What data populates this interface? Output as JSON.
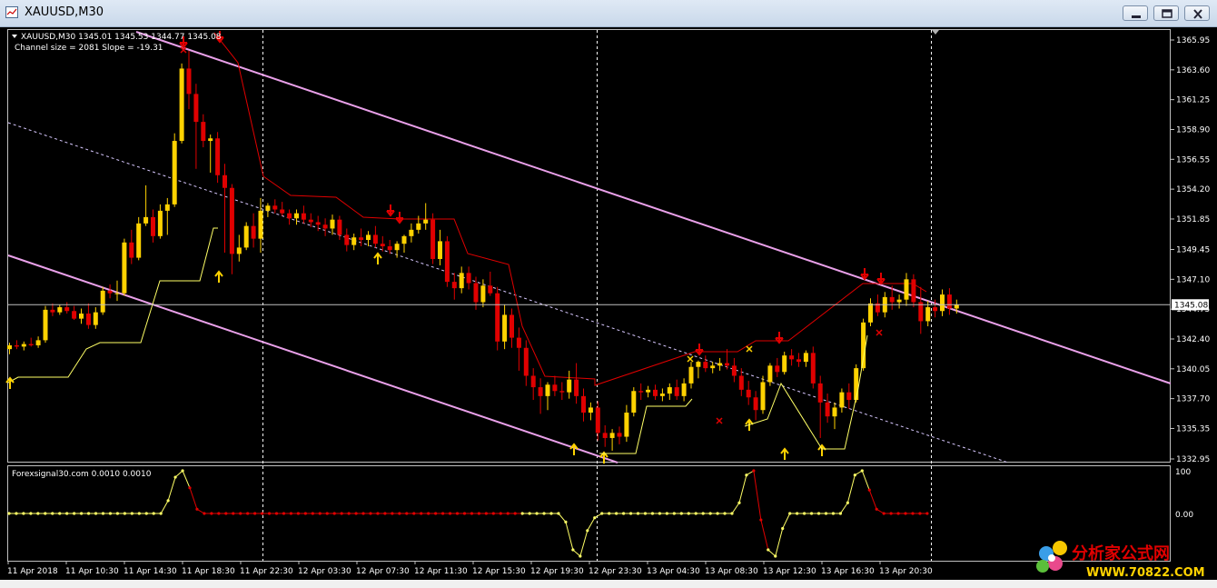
{
  "window": {
    "title": "XAUUSD,M30",
    "icon": "chart-window-icon",
    "buttons": [
      "minimize-icon",
      "restore-icon",
      "close-icon"
    ]
  },
  "chart": {
    "info_line": "XAUUSD,M30  1345.01 1345.53 1344.77 1345.08",
    "channel_line": "Channel size = 2081 Slope = -19.31",
    "current_price_label": "1345.08",
    "indicator_label": "Forexsignal30.com 0.0010 0.0010",
    "indicator_axis": [
      "100",
      "0.00"
    ],
    "watermark_top": "分析家公式网",
    "watermark_bottom": "WWW.70822.COM",
    "colors": {
      "bull": "#ffd200",
      "bear": "#e00000",
      "channel": "#e9a0e9",
      "stop_red": "#e00000",
      "stop_yellow": "#ffff66",
      "grid": "#ffffff"
    }
  },
  "chart_data": {
    "type": "candlestick",
    "symbol": "XAUUSD",
    "timeframe": "M30",
    "y_ticks": [
      1365.95,
      1363.6,
      1361.25,
      1358.9,
      1356.55,
      1354.2,
      1351.85,
      1349.45,
      1347.1,
      1344.75,
      1342.4,
      1340.05,
      1337.7,
      1335.35,
      1332.95
    ],
    "x_ticks": [
      "11 Apr 2018",
      "11 Apr 10:30",
      "11 Apr 14:30",
      "11 Apr 18:30",
      "11 Apr 22:30",
      "12 Apr 03:30",
      "12 Apr 07:30",
      "12 Apr 11:30",
      "12 Apr 15:30",
      "12 Apr 19:30",
      "12 Apr 23:30",
      "13 Apr 04:30",
      "13 Apr 08:30",
      "13 Apr 12:30",
      "13 Apr 16:30",
      "13 Apr 20:30"
    ],
    "ohlc": [
      [
        1341.6,
        1342.1,
        1341.2,
        1341.9
      ],
      [
        1341.9,
        1342.3,
        1341.6,
        1341.8
      ],
      [
        1341.8,
        1342.2,
        1341.5,
        1342.0
      ],
      [
        1342.0,
        1342.5,
        1341.8,
        1341.9
      ],
      [
        1341.9,
        1342.6,
        1341.7,
        1342.3
      ],
      [
        1342.3,
        1345.0,
        1342.1,
        1344.7
      ],
      [
        1344.7,
        1345.2,
        1344.2,
        1344.5
      ],
      [
        1344.5,
        1345.1,
        1344.3,
        1344.9
      ],
      [
        1344.9,
        1345.3,
        1344.4,
        1344.6
      ],
      [
        1344.6,
        1345.0,
        1343.9,
        1344.0
      ],
      [
        1344.0,
        1344.8,
        1343.6,
        1344.4
      ],
      [
        1344.4,
        1345.2,
        1343.2,
        1343.5
      ],
      [
        1343.5,
        1344.9,
        1343.2,
        1344.5
      ],
      [
        1344.5,
        1346.5,
        1344.3,
        1346.2
      ],
      [
        1346.2,
        1346.7,
        1345.6,
        1346.0
      ],
      [
        1346.0,
        1347.0,
        1345.4,
        1346.0
      ],
      [
        1346.0,
        1350.3,
        1345.8,
        1350.0
      ],
      [
        1350.0,
        1351.0,
        1348.3,
        1348.8
      ],
      [
        1348.8,
        1352.0,
        1348.6,
        1351.5
      ],
      [
        1351.5,
        1354.5,
        1351.3,
        1352.0
      ],
      [
        1352.0,
        1352.6,
        1350.0,
        1350.5
      ],
      [
        1350.5,
        1353.0,
        1350.3,
        1352.5
      ],
      [
        1352.5,
        1353.5,
        1350.6,
        1353.0
      ],
      [
        1353.0,
        1358.6,
        1352.8,
        1358.0
      ],
      [
        1358.0,
        1364.1,
        1357.8,
        1363.7
      ],
      [
        1363.7,
        1365.1,
        1360.5,
        1361.7
      ],
      [
        1361.7,
        1362.5,
        1355.8,
        1359.5
      ],
      [
        1359.5,
        1360.1,
        1357.5,
        1358.0
      ],
      [
        1358.0,
        1358.5,
        1355.5,
        1358.2
      ],
      [
        1358.2,
        1358.7,
        1354.7,
        1355.3
      ],
      [
        1355.3,
        1356.2,
        1349.2,
        1354.3
      ],
      [
        1354.3,
        1354.6,
        1347.5,
        1349.1
      ],
      [
        1349.1,
        1350.6,
        1348.5,
        1349.6
      ],
      [
        1349.6,
        1351.6,
        1349.4,
        1351.3
      ],
      [
        1351.3,
        1352.3,
        1349.6,
        1350.3
      ],
      [
        1350.3,
        1353.5,
        1349.2,
        1352.5
      ],
      [
        1352.5,
        1353.1,
        1352.0,
        1352.9
      ],
      [
        1352.9,
        1353.4,
        1352.3,
        1352.6
      ],
      [
        1352.6,
        1353.2,
        1352.1,
        1352.3
      ],
      [
        1352.3,
        1352.6,
        1351.4,
        1351.9
      ],
      [
        1351.9,
        1352.6,
        1351.4,
        1352.3
      ],
      [
        1352.3,
        1352.9,
        1351.5,
        1351.8
      ],
      [
        1351.8,
        1352.3,
        1351.2,
        1351.6
      ],
      [
        1351.6,
        1352.1,
        1350.9,
        1351.4
      ],
      [
        1351.4,
        1351.9,
        1350.5,
        1351.1
      ],
      [
        1351.1,
        1352.2,
        1350.6,
        1351.8
      ],
      [
        1351.8,
        1352.1,
        1350.2,
        1350.6
      ],
      [
        1350.6,
        1351.1,
        1349.3,
        1349.8
      ],
      [
        1349.8,
        1350.7,
        1349.4,
        1350.4
      ],
      [
        1350.4,
        1351.1,
        1349.7,
        1350.2
      ],
      [
        1350.2,
        1350.9,
        1349.7,
        1350.6
      ],
      [
        1350.6,
        1351.3,
        1349.6,
        1349.9
      ],
      [
        1349.9,
        1350.5,
        1349.3,
        1349.7
      ],
      [
        1349.7,
        1350.2,
        1349.1,
        1349.4
      ],
      [
        1349.4,
        1350.1,
        1348.8,
        1349.9
      ],
      [
        1349.9,
        1350.6,
        1349.2,
        1350.5
      ],
      [
        1350.5,
        1351.5,
        1350.0,
        1351.0
      ],
      [
        1351.0,
        1352.1,
        1350.7,
        1351.5
      ],
      [
        1351.5,
        1353.1,
        1351.0,
        1351.8
      ],
      [
        1351.8,
        1352.3,
        1348.3,
        1348.7
      ],
      [
        1348.7,
        1351.0,
        1348.2,
        1350.1
      ],
      [
        1350.1,
        1350.5,
        1346.5,
        1346.9
      ],
      [
        1346.9,
        1347.6,
        1345.5,
        1346.4
      ],
      [
        1346.4,
        1348.1,
        1346.0,
        1347.6
      ],
      [
        1347.6,
        1348.1,
        1346.3,
        1346.8
      ],
      [
        1346.8,
        1347.3,
        1344.7,
        1345.3
      ],
      [
        1345.3,
        1347.1,
        1344.9,
        1346.6
      ],
      [
        1346.6,
        1347.7,
        1345.8,
        1346.0
      ],
      [
        1346.0,
        1346.5,
        1341.5,
        1342.2
      ],
      [
        1342.2,
        1345.1,
        1341.6,
        1344.3
      ],
      [
        1344.3,
        1344.8,
        1341.7,
        1342.5
      ],
      [
        1342.5,
        1343.3,
        1339.9,
        1341.7
      ],
      [
        1341.7,
        1342.3,
        1338.7,
        1339.5
      ],
      [
        1339.5,
        1340.1,
        1337.6,
        1338.6
      ],
      [
        1338.6,
        1339.3,
        1336.5,
        1337.9
      ],
      [
        1337.9,
        1339.0,
        1336.8,
        1338.8
      ],
      [
        1338.8,
        1339.5,
        1337.9,
        1338.3
      ],
      [
        1338.3,
        1339.0,
        1337.6,
        1338.2
      ],
      [
        1338.2,
        1339.9,
        1337.7,
        1339.2
      ],
      [
        1339.2,
        1340.5,
        1337.3,
        1337.9
      ],
      [
        1337.9,
        1338.5,
        1335.9,
        1336.6
      ],
      [
        1336.6,
        1337.4,
        1336.0,
        1337.0
      ],
      [
        1337.0,
        1337.5,
        1334.4,
        1335.0
      ],
      [
        1335.0,
        1335.6,
        1333.9,
        1334.6
      ],
      [
        1334.6,
        1335.3,
        1333.6,
        1335.0
      ],
      [
        1335.0,
        1335.5,
        1334.1,
        1334.7
      ],
      [
        1334.7,
        1337.2,
        1334.3,
        1336.6
      ],
      [
        1336.6,
        1338.6,
        1336.3,
        1338.3
      ],
      [
        1338.3,
        1338.9,
        1337.6,
        1338.2
      ],
      [
        1338.2,
        1338.7,
        1337.8,
        1338.4
      ],
      [
        1338.4,
        1338.8,
        1337.6,
        1337.9
      ],
      [
        1337.9,
        1338.5,
        1337.5,
        1338.1
      ],
      [
        1338.1,
        1338.9,
        1337.6,
        1338.6
      ],
      [
        1338.6,
        1339.2,
        1337.6,
        1337.9
      ],
      [
        1337.9,
        1339.3,
        1337.5,
        1338.9
      ],
      [
        1338.9,
        1340.6,
        1338.5,
        1340.2
      ],
      [
        1340.2,
        1340.7,
        1339.3,
        1340.6
      ],
      [
        1340.6,
        1341.1,
        1339.8,
        1340.1
      ],
      [
        1340.1,
        1340.6,
        1339.7,
        1340.3
      ],
      [
        1340.3,
        1340.9,
        1339.9,
        1340.5
      ],
      [
        1340.5,
        1341.6,
        1340.0,
        1340.3
      ],
      [
        1340.3,
        1340.9,
        1339.0,
        1339.5
      ],
      [
        1339.5,
        1340.1,
        1337.9,
        1338.4
      ],
      [
        1338.4,
        1339.1,
        1337.2,
        1337.8
      ],
      [
        1337.8,
        1338.3,
        1336.0,
        1336.8
      ],
      [
        1336.8,
        1339.5,
        1336.5,
        1339.0
      ],
      [
        1339.0,
        1340.5,
        1338.7,
        1340.3
      ],
      [
        1340.3,
        1340.9,
        1339.4,
        1339.8
      ],
      [
        1339.8,
        1341.4,
        1339.6,
        1341.1
      ],
      [
        1341.1,
        1341.6,
        1340.3,
        1340.8
      ],
      [
        1340.8,
        1341.3,
        1340.2,
        1340.6
      ],
      [
        1340.6,
        1341.5,
        1340.2,
        1341.3
      ],
      [
        1341.3,
        1341.8,
        1338.5,
        1338.9
      ],
      [
        1338.9,
        1339.5,
        1334.6,
        1337.4
      ],
      [
        1337.4,
        1338.1,
        1335.8,
        1336.3
      ],
      [
        1336.3,
        1337.4,
        1335.3,
        1337.0
      ],
      [
        1337.0,
        1338.5,
        1336.6,
        1338.2
      ],
      [
        1338.2,
        1338.9,
        1336.9,
        1337.6
      ],
      [
        1337.6,
        1340.4,
        1337.4,
        1340.1
      ],
      [
        1340.1,
        1344.0,
        1339.9,
        1343.7
      ],
      [
        1343.7,
        1345.6,
        1343.4,
        1345.2
      ],
      [
        1345.2,
        1345.9,
        1344.2,
        1344.5
      ],
      [
        1344.5,
        1346.1,
        1344.1,
        1345.7
      ],
      [
        1345.7,
        1346.6,
        1344.7,
        1345.3
      ],
      [
        1345.3,
        1345.9,
        1344.8,
        1345.5
      ],
      [
        1345.5,
        1347.6,
        1345.0,
        1347.1
      ],
      [
        1347.1,
        1347.5,
        1344.9,
        1345.3
      ],
      [
        1345.3,
        1346.5,
        1342.8,
        1343.8
      ],
      [
        1343.8,
        1345.4,
        1343.4,
        1344.9
      ],
      [
        1344.9,
        1345.5,
        1344.1,
        1344.6
      ],
      [
        1344.6,
        1346.3,
        1344.2,
        1345.9
      ],
      [
        1345.9,
        1346.4,
        1344.3,
        1344.8
      ],
      [
        1344.8,
        1345.5,
        1344.4,
        1345.1
      ]
    ]
  }
}
